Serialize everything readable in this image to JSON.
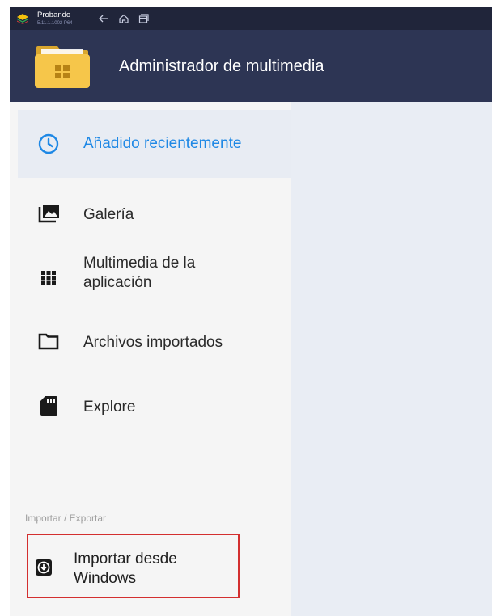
{
  "system_bar": {
    "app_name": "Probando",
    "app_version": "5.11.1.1002 P64",
    "icons": [
      "back-arrow-icon",
      "home-icon",
      "recents-icon"
    ]
  },
  "header": {
    "title": "Administrador de multimedia",
    "logo_icon": "folder-windows-icon"
  },
  "sidebar": {
    "items": [
      {
        "label": "Añadido recientemente",
        "icon": "clock-icon",
        "active": true
      },
      {
        "label": "Galería",
        "icon": "gallery-icon",
        "active": false
      },
      {
        "label": "Multimedia de la\naplicación",
        "icon": "grid-icon",
        "active": false
      },
      {
        "label": "Archivos importados",
        "icon": "folder-icon",
        "active": false
      },
      {
        "label": "Explore",
        "icon": "sd-card-icon",
        "active": false
      }
    ],
    "section_header": "Importar / Exportar",
    "import_item": {
      "label": "Importar desde\nWindows",
      "icon": "download-icon"
    }
  },
  "colors": {
    "system_bar": "#20253a",
    "title_bar": "#2d3554",
    "accent": "#1e88e5",
    "sidebar_bg": "#f5f5f5",
    "content_bg": "#e9edf4",
    "highlight_box": "#d32f2f"
  }
}
